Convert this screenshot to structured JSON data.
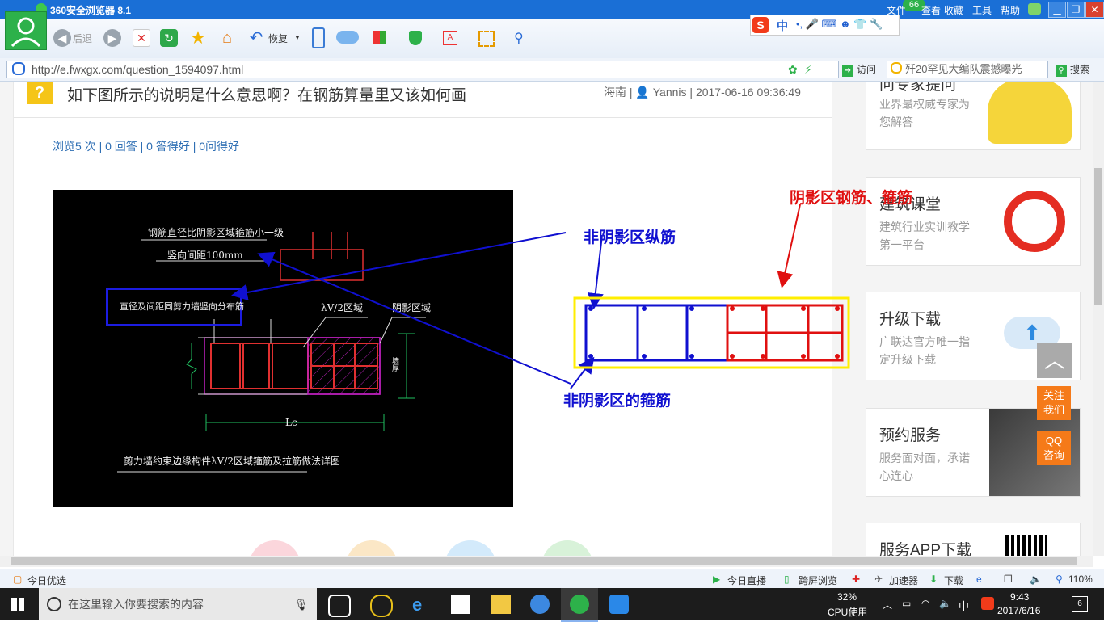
{
  "window": {
    "title": "360安全浏览器 8.1",
    "menu": [
      "文件",
      "查看",
      "收藏",
      "工具",
      "帮助"
    ],
    "badge": "66"
  },
  "toolbar": {
    "back_label": "后退",
    "restore_label": "恢复",
    "ime_text": "中"
  },
  "address": {
    "url": "http://e.fwxgx.com/question_1594097.html",
    "visit_label": "访问",
    "search_value": "歼20罕见大编队震撼曝光",
    "search_label": "搜索"
  },
  "question": {
    "title": "如下图所示的说明是什么意思啊？在钢筋算量里又该如何画",
    "region": "海南",
    "user": "Yannis",
    "datetime": "2017-06-16 09:36:49",
    "stats": "浏览5 次 | 0 回答 | 0 答得好 | 0问得好"
  },
  "cad": {
    "note1": "钢筋直径比阴影区域箍筋小一级",
    "note2": "竖向间距100mm",
    "note3": "直径及间距同剪力墙竖向分布筋",
    "label_av2": "λV/2区域",
    "label_shadow": "阴影区域",
    "label_lc": "Lc",
    "caption": "剪力墙约束边缘构件λV/2区域箍筋及拉筋做法详图",
    "dim_label": "墙厚"
  },
  "annotations": {
    "non_shadow_longitudinal": "非阴影区纵筋",
    "non_shadow_stirrup": "非阴影区的箍筋",
    "shadow": "阴影区钢筋、箍筋"
  },
  "sidebar": {
    "cards": [
      {
        "title": "问专家提问",
        "desc": "业界最权威专家为您解答"
      },
      {
        "title": "建筑课堂",
        "desc": "建筑行业实训教学第一平台"
      },
      {
        "title": "升级下载",
        "desc": "广联达官方唯一指定升级下载"
      },
      {
        "title": "预约服务",
        "desc": "服务面对面，承诺心连心"
      },
      {
        "title": "服务APP下载",
        "desc": ""
      }
    ],
    "follow": "关注我们",
    "qq": "QQ咨询"
  },
  "statusbar": {
    "left": "今日优选",
    "live": "今日直播",
    "cross": "跨屏浏览",
    "accel": "加速器",
    "download": "下载",
    "zoom": "110%"
  },
  "taskbar": {
    "search_placeholder": "在这里输入你要搜索的内容",
    "cpu_percent": "32%",
    "cpu_label": "CPU使用",
    "ime": "中",
    "time": "9:43",
    "date": "2017/6/16",
    "notif_count": "6"
  },
  "colors": {
    "title_bar": "#1a6fd6",
    "annotation_blue": "#1010d0",
    "annotation_red": "#e01010",
    "highlight_yellow": "#ffee00",
    "orange": "#f57a19"
  }
}
